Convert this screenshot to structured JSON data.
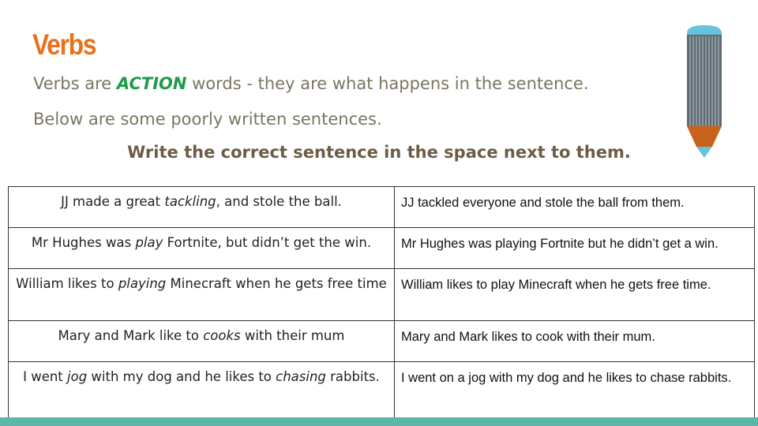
{
  "slide": {
    "title": "Verbs",
    "line1": {
      "before": "Verbs are ",
      "emphasis": "ACTION",
      "after": " words - they are what happens in the sentence."
    },
    "line2": "Below are some poorly written sentences.",
    "instruction": "Write the correct sentence in the space next to them."
  },
  "rows": [
    {
      "original": {
        "before": "JJ made a great ",
        "italic": "tackling",
        "after": ", and stole the ball."
      },
      "answer": "JJ tackled everyone and stole the ball from them."
    },
    {
      "original": {
        "before": "Mr Hughes was ",
        "italic": "play",
        "after": " Fortnite, but didn’t get the win."
      },
      "answer": "Mr Hughes was playing Fortnite but he didn’t get a win."
    },
    {
      "original": {
        "before": "William likes to ",
        "italic": "playing",
        "after": " Minecraft when he gets free time"
      },
      "answer": "William likes to play Minecraft when he gets free time."
    },
    {
      "original": {
        "before": "Mary and Mark like to ",
        "italic": "cooks",
        "after": " with their mum"
      },
      "answer": "Mary and Mark likes to cook with their mum."
    },
    {
      "original": {
        "before": "I went ",
        "italic": "jog",
        "middle": " with my dog and he likes to ",
        "italic2": "chasing",
        "after": " rabbits."
      },
      "answer": "I went on a jog with my dog and he likes to chase rabbits."
    }
  ],
  "decoration": {
    "icon": "pencil-icon",
    "colors": {
      "title": "#e8711c",
      "body_text": "#7a7560",
      "action_word": "#1e9a4b",
      "instruction": "#6b5d45",
      "pencil_body": "#5f6b72",
      "pencil_cap": "#66c3dc",
      "pencil_wood": "#c8621a",
      "bottom_bar": "#5ab8a8"
    }
  }
}
